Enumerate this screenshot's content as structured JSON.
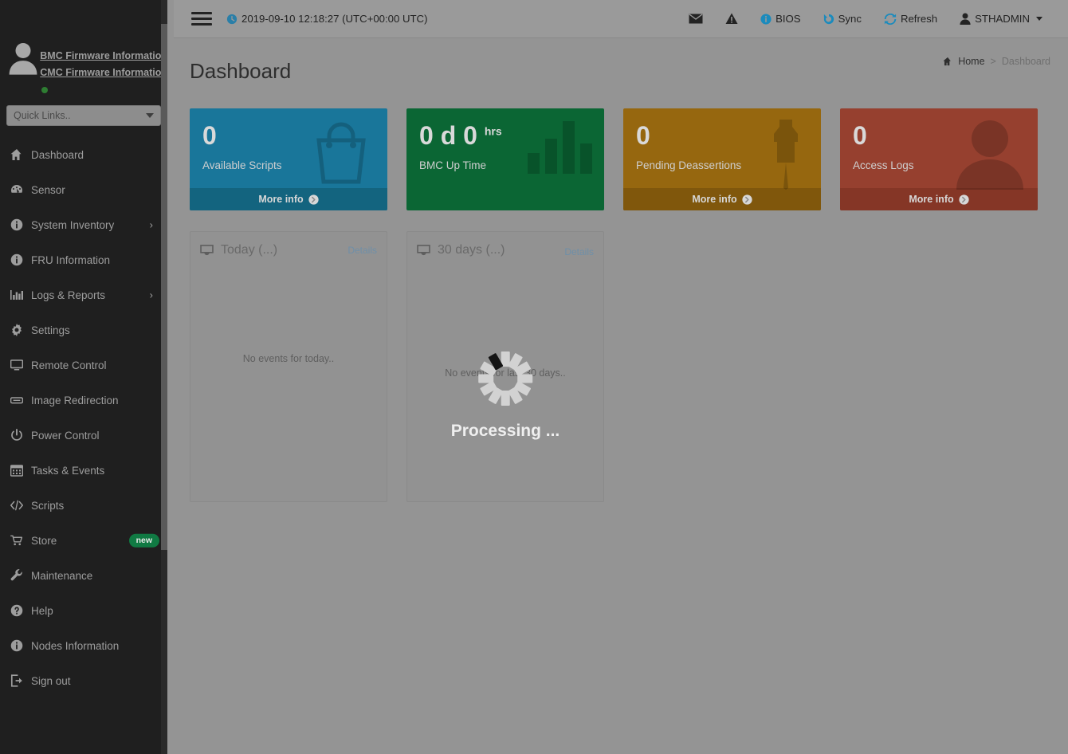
{
  "sidebar": {
    "profile": {
      "bmc_link": "BMC Firmware Information",
      "cmc_link": "CMC Firmware Information",
      "status_color": "#2e7d32"
    },
    "quick_links_placeholder": "Quick Links..",
    "items": [
      {
        "label": "Dashboard",
        "icon": "home-icon",
        "submenu": false,
        "badge": ""
      },
      {
        "label": "Sensor",
        "icon": "gauge-icon",
        "submenu": false,
        "badge": ""
      },
      {
        "label": "System Inventory",
        "icon": "info-icon",
        "submenu": true,
        "badge": ""
      },
      {
        "label": "FRU Information",
        "icon": "info-icon",
        "submenu": false,
        "badge": ""
      },
      {
        "label": "Logs & Reports",
        "icon": "bar-chart-icon",
        "submenu": true,
        "badge": ""
      },
      {
        "label": "Settings",
        "icon": "gear-icon",
        "submenu": false,
        "badge": ""
      },
      {
        "label": "Remote Control",
        "icon": "monitor-icon",
        "submenu": false,
        "badge": ""
      },
      {
        "label": "Image Redirection",
        "icon": "disc-icon",
        "submenu": false,
        "badge": ""
      },
      {
        "label": "Power Control",
        "icon": "power-icon",
        "submenu": false,
        "badge": ""
      },
      {
        "label": "Tasks & Events",
        "icon": "calendar-icon",
        "submenu": false,
        "badge": ""
      },
      {
        "label": "Scripts",
        "icon": "code-icon",
        "submenu": false,
        "badge": ""
      },
      {
        "label": "Store",
        "icon": "cart-icon",
        "submenu": false,
        "badge": "new"
      },
      {
        "label": "Maintenance",
        "icon": "wrench-icon",
        "submenu": false,
        "badge": ""
      },
      {
        "label": "Help",
        "icon": "question-icon",
        "submenu": false,
        "badge": ""
      },
      {
        "label": "Nodes Information",
        "icon": "info-icon",
        "submenu": false,
        "badge": ""
      },
      {
        "label": "Sign out",
        "icon": "signout-icon",
        "submenu": false,
        "badge": ""
      }
    ]
  },
  "topbar": {
    "datetime": "2019-09-10 12:18:27 (UTC+00:00 UTC)",
    "mail_icon": "envelope-icon",
    "warning_icon": "warning-triangle-icon",
    "bios_label": "BIOS",
    "sync_label": "Sync",
    "refresh_label": "Refresh",
    "user_label": "STHADMIN",
    "accent_color": "#1b8bbd"
  },
  "main": {
    "page_title": "Dashboard",
    "breadcrumb": {
      "home": "Home",
      "separator": ">",
      "current": "Dashboard"
    },
    "cards": [
      {
        "number": "0",
        "unit": "",
        "label": "Available Scripts",
        "more_info": "More info",
        "has_footer": true,
        "icon": "handbag-icon",
        "color": "#19769a",
        "foot_color": "#13647f"
      },
      {
        "number": "0 d 0",
        "unit": "hrs",
        "label": "BMC Up Time",
        "more_info": "",
        "has_footer": false,
        "icon": "bar-chart-icon",
        "color": "#0b6634",
        "foot_color": "#095629"
      },
      {
        "number": "0",
        "unit": "",
        "label": "Pending Deassertions",
        "more_info": "More info",
        "has_footer": true,
        "icon": "pushpin-icon",
        "color": "#96670f",
        "foot_color": "#80570c"
      },
      {
        "number": "0",
        "unit": "",
        "label": "Access Logs",
        "more_info": "More info",
        "has_footer": true,
        "icon": "person-icon",
        "color": "#96402f",
        "foot_color": "#853626"
      }
    ],
    "panels": [
      {
        "title": "Today (...)",
        "details": "Details",
        "empty_text": "No events for today..",
        "icon": "inbox-icon",
        "show_spinner": false
      },
      {
        "title": "30 days (...)",
        "details": "Details",
        "empty_text": "No events for last 30 days..",
        "icon": "inbox-icon",
        "show_spinner": true
      }
    ],
    "processing_text": "Processing ..."
  }
}
